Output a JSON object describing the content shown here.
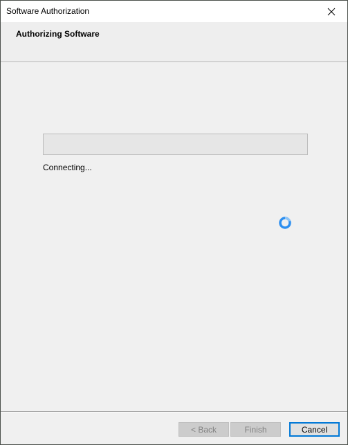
{
  "window": {
    "title": "Software Authorization",
    "close_icon": "close-icon"
  },
  "header": {
    "title": "Authorizing Software"
  },
  "progress": {
    "value_percent": 0,
    "status_text": "Connecting..."
  },
  "spinner": {
    "icon": "loading-spinner-icon",
    "color": "#1e90ff"
  },
  "buttons": {
    "back_label": "< Back",
    "finish_label": "Finish",
    "cancel_label": "Cancel",
    "back_enabled": false,
    "finish_enabled": false,
    "cancel_enabled": true
  },
  "colors": {
    "accent": "#0078d7"
  }
}
